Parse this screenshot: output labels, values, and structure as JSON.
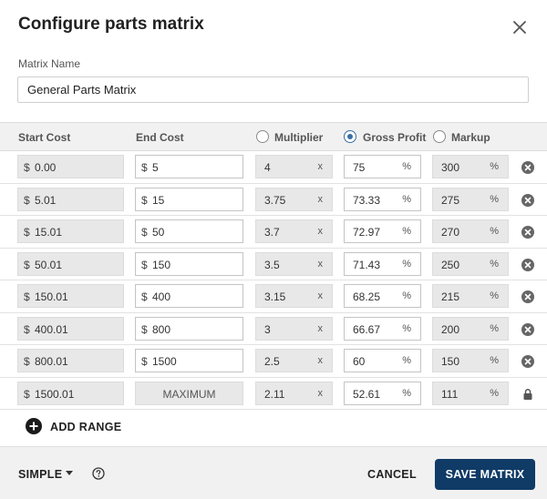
{
  "dialog": {
    "title": "Configure parts matrix",
    "matrix_name_label": "Matrix Name",
    "matrix_name_value": "General Parts Matrix"
  },
  "columns": {
    "start_cost": "Start Cost",
    "end_cost": "End Cost",
    "multiplier": "Multiplier",
    "gross_profit": "Gross Profit",
    "markup": "Markup"
  },
  "selected_mode": "gross_profit",
  "symbols": {
    "currency": "$",
    "times": "x",
    "percent": "%"
  },
  "rows": [
    {
      "start": "0.00",
      "end": "5",
      "multiplier": "4",
      "gross_profit": "75",
      "markup": "300",
      "action": "remove-icon"
    },
    {
      "start": "5.01",
      "end": "15",
      "multiplier": "3.75",
      "gross_profit": "73.33",
      "markup": "275",
      "action": "remove-icon"
    },
    {
      "start": "15.01",
      "end": "50",
      "multiplier": "3.7",
      "gross_profit": "72.97",
      "markup": "270",
      "action": "remove-icon"
    },
    {
      "start": "50.01",
      "end": "150",
      "multiplier": "3.5",
      "gross_profit": "71.43",
      "markup": "250",
      "action": "remove-icon"
    },
    {
      "start": "150.01",
      "end": "400",
      "multiplier": "3.15",
      "gross_profit": "68.25",
      "markup": "215",
      "action": "remove-icon"
    },
    {
      "start": "400.01",
      "end": "800",
      "multiplier": "3",
      "gross_profit": "66.67",
      "markup": "200",
      "action": "remove-icon"
    },
    {
      "start": "800.01",
      "end": "1500",
      "multiplier": "2.5",
      "gross_profit": "60",
      "markup": "150",
      "action": "remove-icon"
    },
    {
      "start": "1500.01",
      "end": "MAXIMUM",
      "multiplier": "2.11",
      "gross_profit": "52.61",
      "markup": "111",
      "action": "lock-icon"
    }
  ],
  "add_range_label": "ADD RANGE",
  "footer": {
    "mode_label": "SIMPLE",
    "cancel_label": "CANCEL",
    "save_label": "SAVE MATRIX"
  },
  "colors": {
    "primary": "#0f3b66",
    "radio_selected": "#3a6ea5",
    "readonly_bg": "#e8e8e8",
    "header_bg": "#f1f1f1"
  }
}
